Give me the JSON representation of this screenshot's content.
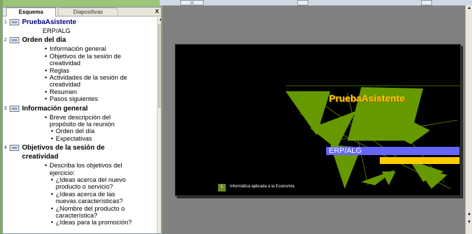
{
  "tabs": {
    "outline": "Esquema",
    "slides": "Diapositivas",
    "close": "x"
  },
  "outline": [
    {
      "num": "1",
      "title": "PruebaAsistente",
      "items": [
        {
          "text": "ERP/ALG",
          "level": 0
        }
      ]
    },
    {
      "num": "2",
      "title": "Orden del día",
      "items": [
        {
          "text": "Información general",
          "level": 1
        },
        {
          "text": "Objetivos de la sesión de",
          "level": 1
        },
        {
          "text": "creatividad",
          "level": 1,
          "cont": true
        },
        {
          "text": "Reglas",
          "level": 1
        },
        {
          "text": "Actividades de la sesión de",
          "level": 1
        },
        {
          "text": "creatividad",
          "level": 1,
          "cont": true
        },
        {
          "text": "Resumen",
          "level": 1
        },
        {
          "text": "Pasos siguientes",
          "level": 1
        }
      ]
    },
    {
      "num": "3",
      "title": "Información general",
      "items": [
        {
          "text": "Breve descripción del",
          "level": 1
        },
        {
          "text": "propósito de la reunión",
          "level": 1,
          "cont": true
        },
        {
          "text": "Orden del día",
          "level": 2
        },
        {
          "text": "Expectativas",
          "level": 2
        }
      ]
    },
    {
      "num": "4",
      "title": "Objetivos de la sesión de",
      "title2": "creatividad",
      "items": [
        {
          "text": "Describa los objetivos del",
          "level": 1
        },
        {
          "text": "ejercicio:",
          "level": 1,
          "cont": true
        },
        {
          "text": "¿Ideas acerca del nuevo",
          "level": 2
        },
        {
          "text": "producto o servicio?",
          "level": 2,
          "cont": true
        },
        {
          "text": "¿Ideas acerca de las",
          "level": 2
        },
        {
          "text": "nuevas características?",
          "level": 2,
          "cont": true
        },
        {
          "text": "¿Nombre del producto o",
          "level": 2
        },
        {
          "text": "característica?",
          "level": 2,
          "cont": true
        },
        {
          "text": "¿Ideas para la promoción?",
          "level": 2
        }
      ]
    }
  ],
  "slide": {
    "title": "PruebaAsistente",
    "subtitle": "ERP/ALG",
    "footer_number": "1",
    "footer_text": "Informática aplicada a la Economía",
    "title_color": "#ffcc00",
    "bar_color": "#6666ff",
    "shape_color": "#669900"
  }
}
